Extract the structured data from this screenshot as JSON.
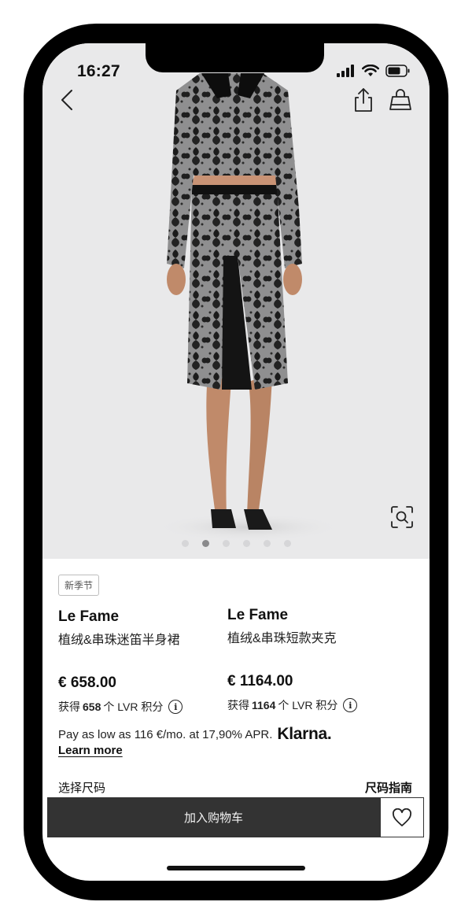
{
  "status": {
    "time": "16:27"
  },
  "nav": {
    "back_icon": "chevron-left-icon",
    "share_icon": "share-icon",
    "bag_icon": "shopping-bag-icon"
  },
  "gallery": {
    "image_count": 6,
    "active_index": 1,
    "visual_search_icon": "visual-search-icon"
  },
  "badge": "新季节",
  "products": [
    {
      "brand": "Le Fame",
      "name": "植绒&串珠迷笛半身裙",
      "price": "€ 658.00",
      "points_prefix": "获得",
      "points": "658",
      "points_suffix": "个 LVR 积分"
    },
    {
      "brand": "Le Fame",
      "name": "植绒&串珠短款夹克",
      "price": "€ 1164.00",
      "points_prefix": "获得",
      "points": "1164",
      "points_suffix": "个 LVR 积分"
    }
  ],
  "klarna": {
    "text": "Pay as low as 116 €/mo. at 17,90% APR.",
    "logo": "Klarna.",
    "learn_more": "Learn more"
  },
  "size": {
    "label": "选择尺码",
    "guide": "尺码指南"
  },
  "actions": {
    "add_to_cart": "加入购物车",
    "wishlist_icon": "heart-icon"
  },
  "colors": {
    "hero_bg": "#e9e9ea",
    "cart_button": "#333333",
    "text": "#111111"
  }
}
